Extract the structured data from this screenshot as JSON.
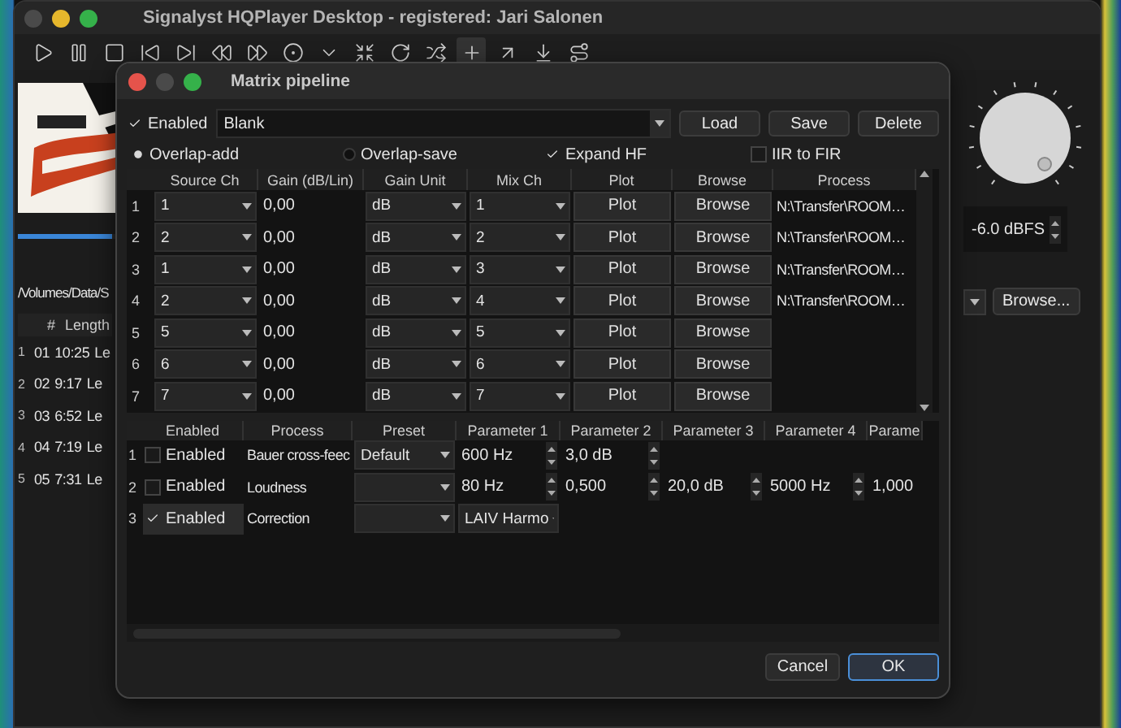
{
  "main_window": {
    "title": "Signalyst HQPlayer Desktop - registered: Jari Salonen",
    "playback": {
      "level": 0.7
    },
    "path": "/Volumes/Data/S",
    "track_columns": [
      "#",
      "Length"
    ],
    "tracks": [
      {
        "index": "1",
        "number": "01",
        "length": "10:25",
        "title": "Le"
      },
      {
        "index": "2",
        "number": "02",
        "length": "9:17",
        "title": "Le"
      },
      {
        "index": "3",
        "number": "03",
        "length": "6:52",
        "title": "Le"
      },
      {
        "index": "4",
        "number": "04",
        "length": "7:19",
        "title": "Le"
      },
      {
        "index": "5",
        "number": "05",
        "length": "7:31",
        "title": "Le"
      }
    ],
    "volume_reading": "-6.0 dBFS",
    "browse_button": "Browse..."
  },
  "dialog": {
    "title": "Matrix pipeline",
    "enabled": {
      "label": "Enabled",
      "checked": true
    },
    "preset": "Blank",
    "buttons": [
      "Load",
      "Save",
      "Delete"
    ],
    "options": [
      {
        "kind": "radio",
        "label": "Overlap-add",
        "selected": true
      },
      {
        "kind": "radio",
        "label": "Overlap-save",
        "selected": false
      },
      {
        "kind": "checkbox",
        "label": "Expand HF",
        "checked": true
      },
      {
        "kind": "checkbox",
        "label": "IIR to FIR",
        "checked": false
      }
    ],
    "matrix": {
      "columns": [
        "Source Ch",
        "Gain (dB/Lin)",
        "Gain Unit",
        "Mix Ch",
        "Plot",
        "Browse",
        "Process"
      ],
      "rows": [
        {
          "index": "1",
          "source": "1",
          "gain": "0,00",
          "unit": "dB",
          "mix": "1",
          "plot": "Plot",
          "browse": "Browse",
          "process": "N:\\Transfer\\ROOM…"
        },
        {
          "index": "2",
          "source": "2",
          "gain": "0,00",
          "unit": "dB",
          "mix": "2",
          "plot": "Plot",
          "browse": "Browse",
          "process": "N:\\Transfer\\ROOM…"
        },
        {
          "index": "3",
          "source": "1",
          "gain": "0,00",
          "unit": "dB",
          "mix": "3",
          "plot": "Plot",
          "browse": "Browse",
          "process": "N:\\Transfer\\ROOM…"
        },
        {
          "index": "4",
          "source": "2",
          "gain": "0,00",
          "unit": "dB",
          "mix": "4",
          "plot": "Plot",
          "browse": "Browse",
          "process": "N:\\Transfer\\ROOM…"
        },
        {
          "index": "5",
          "source": "5",
          "gain": "0,00",
          "unit": "dB",
          "mix": "5",
          "plot": "Plot",
          "browse": "Browse"
        },
        {
          "index": "6",
          "source": "6",
          "gain": "0,00",
          "unit": "dB",
          "mix": "6",
          "plot": "Plot",
          "browse": "Browse"
        },
        {
          "index": "7",
          "source": "7",
          "gain": "0,00",
          "unit": "dB",
          "mix": "7",
          "plot": "Plot",
          "browse": "Browse"
        }
      ]
    },
    "processes": {
      "columns": [
        "Enabled",
        "Process",
        "Preset",
        "Parameter 1",
        "Parameter 2",
        "Parameter 3",
        "Parameter 4",
        "Parame"
      ],
      "rows": [
        {
          "index": "1",
          "selected": false,
          "enabled": {
            "label": "Enabled",
            "checked": false
          },
          "process": "Bauer cross-feec",
          "preset": "Default",
          "params": [
            {
              "kind": "spin",
              "value": "600 Hz"
            },
            {
              "kind": "spin",
              "value": "3,0 dB"
            }
          ]
        },
        {
          "index": "2",
          "selected": false,
          "enabled": {
            "label": "Enabled",
            "checked": false
          },
          "process": "Loudness",
          "preset": "",
          "params": [
            {
              "kind": "spin",
              "value": "80 Hz"
            },
            {
              "kind": "spin",
              "value": "0,500"
            },
            {
              "kind": "spin",
              "value": "20,0 dB"
            },
            {
              "kind": "spin",
              "value": "5000 Hz"
            },
            {
              "kind": "value",
              "value": "1,000"
            }
          ]
        },
        {
          "index": "3",
          "selected": true,
          "enabled": {
            "label": "Enabled",
            "checked": true
          },
          "process": "Correction",
          "preset": "",
          "params": [
            {
              "kind": "combo",
              "value": "LAIV Harmo"
            }
          ]
        }
      ]
    },
    "footer_buttons": [
      "Cancel",
      "OK"
    ]
  }
}
